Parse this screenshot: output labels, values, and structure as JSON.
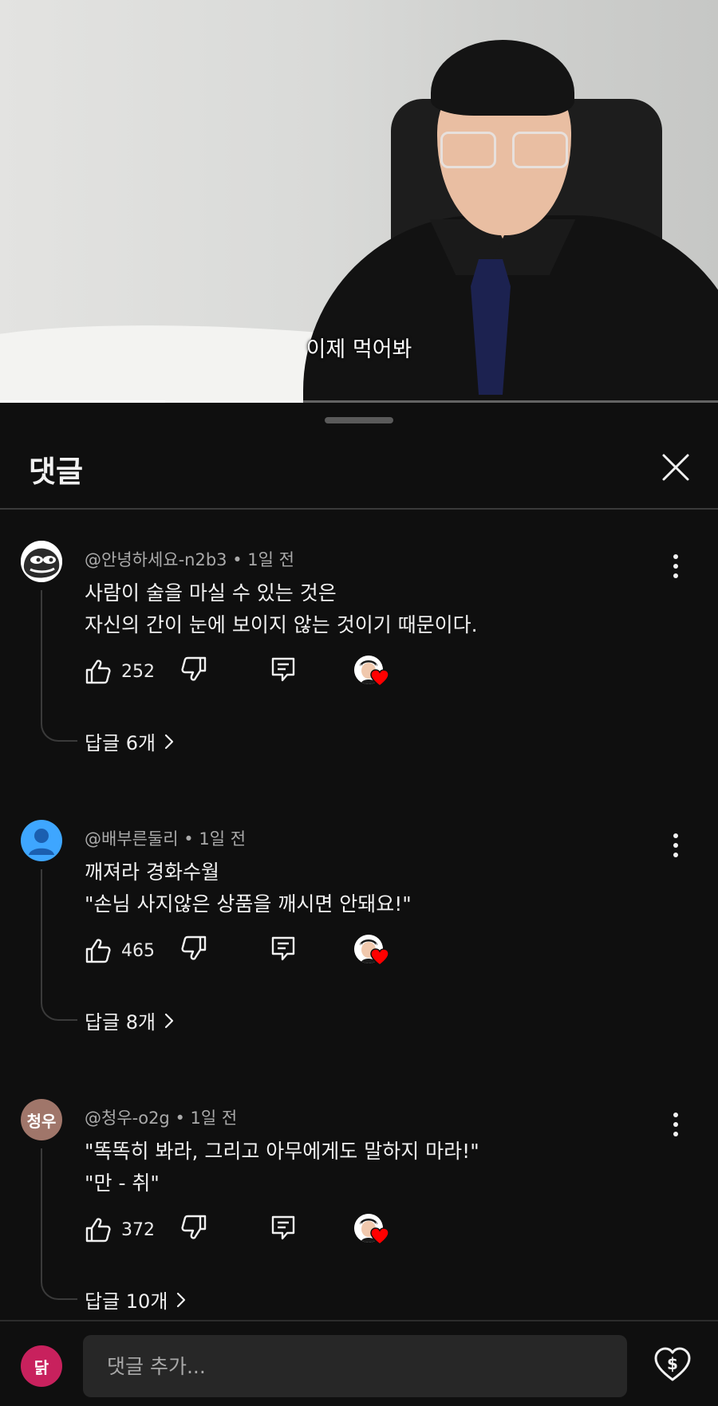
{
  "video": {
    "subtitle": "이제 먹어봐",
    "progress_fraction": 0.23
  },
  "sheet": {
    "title": "댓글"
  },
  "comments": [
    {
      "author": "@안녕하세요-n2b3",
      "time": "1일 전",
      "lines": [
        "사람이 술을 마실 수 있는 것은",
        "자신의 간이 눈에 보이지 않는 것이기 때문이다."
      ],
      "likes": "252",
      "replies": "답글 6개",
      "avatar_type": "pepe-icon",
      "avatar_text": ""
    },
    {
      "author": "@배부른둘리",
      "time": "1일 전",
      "lines": [
        "깨져라 경화수월",
        "\"손님 사지않은 상품을 깨시면 안돼요!\""
      ],
      "likes": "465",
      "replies": "답글 8개",
      "avatar_type": "default-person-icon",
      "avatar_text": ""
    },
    {
      "author": "@청우-o2g",
      "time": "1일 전",
      "lines": [
        "\"똑똑히 봐라, 그리고 아무에게도 말하지 마라!\"",
        "\"만 - 취\""
      ],
      "likes": "372",
      "replies": "답글 10개",
      "avatar_type": "initials",
      "avatar_text": "청우"
    }
  ],
  "bottom_bar": {
    "user_avatar_text": "닭",
    "input_placeholder": "댓글 추가...",
    "thanks_icon": "heart-dollar-icon"
  },
  "colors": {
    "background": "#0f0f0f",
    "heart": "#ff0000",
    "user_avatar": "#c8215d",
    "initials_avatar": "#a0766a",
    "default_avatar": "#3ea6ff"
  }
}
